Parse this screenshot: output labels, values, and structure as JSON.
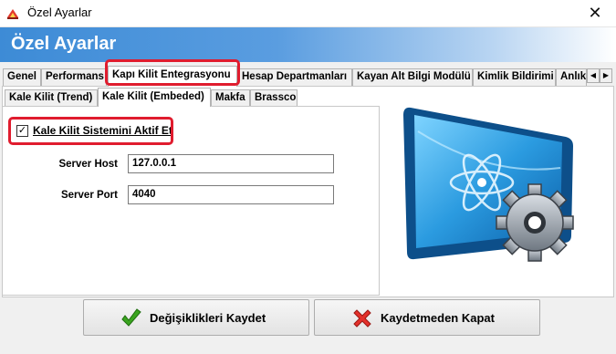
{
  "window": {
    "title": "Özel Ayarlar",
    "close_glyph": "✕",
    "app_icon": "app-logo-icon"
  },
  "header": {
    "title": "Özel Ayarlar"
  },
  "tabs_main": {
    "items": [
      {
        "label": "Genel"
      },
      {
        "label": "Performans"
      },
      {
        "label": "Kapı Kilit Entegrasyonu",
        "active": true
      },
      {
        "label": "Hesap Departmanları"
      },
      {
        "label": "Kayan Alt Bilgi Modülü"
      },
      {
        "label": "Kimlik Bildirimi"
      },
      {
        "label": "Anlık"
      }
    ],
    "scroll_left": "◀",
    "scroll_right": "▶"
  },
  "tabs_sub": {
    "items": [
      {
        "label": "Kale Kilit (Trend)"
      },
      {
        "label": "Kale Kilit (Embeded)",
        "active": true
      },
      {
        "label": "Makfa"
      },
      {
        "label": "Brassco"
      }
    ]
  },
  "settings": {
    "enable_checkbox": {
      "label": "Kale Kilit Sistemini Aktif Et",
      "checked": true,
      "mark": "✓"
    },
    "server_host": {
      "label": "Server Host",
      "value": "127.0.0.1"
    },
    "server_port": {
      "label": "Server Port",
      "value": "4040"
    }
  },
  "buttons": {
    "save": {
      "label": "Değişiklikleri Kaydet",
      "icon": "checkmark-icon"
    },
    "cancel": {
      "label": "Kaydetmeden Kapat",
      "icon": "x-icon"
    }
  },
  "colors": {
    "accent_blue": "#3d8bd6",
    "highlight_red": "#e01c2e",
    "check_green": "#3aa41f",
    "cancel_red": "#e4312b"
  }
}
